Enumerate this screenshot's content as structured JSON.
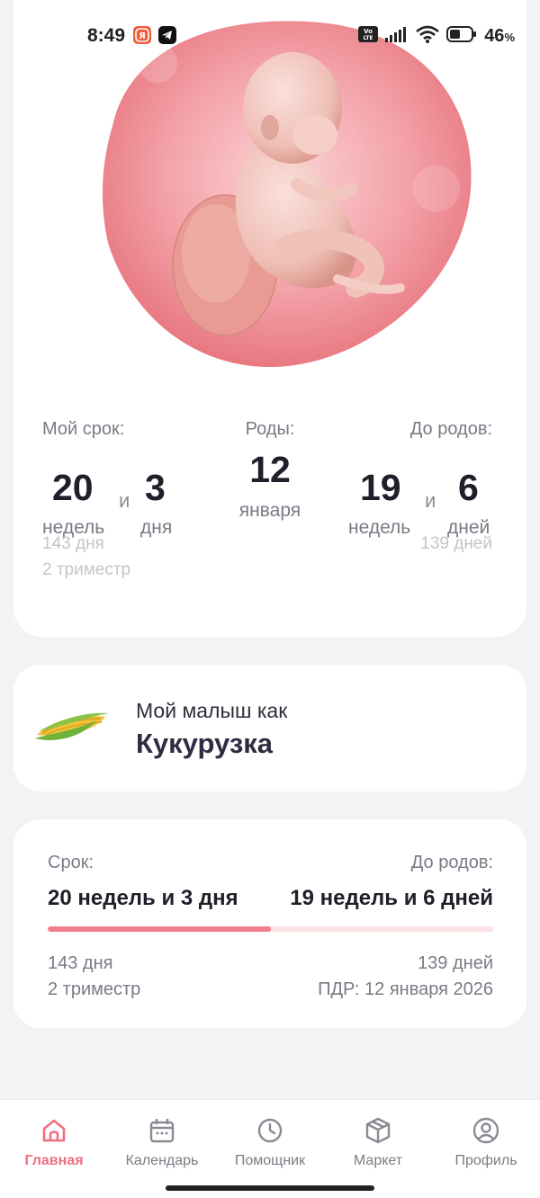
{
  "status_bar": {
    "time": "8:49",
    "battery": "46",
    "battery_unit": "%",
    "network_badge": "Vo LTE",
    "icons": [
      "yandex-app-icon",
      "telegram-icon",
      "volte-icon",
      "signal-icon",
      "wifi-icon",
      "battery-icon"
    ]
  },
  "colors": {
    "accent": "#ee6f80",
    "progress_fill": "#ee7f8b",
    "progress_track": "#fbe1e4",
    "background": "#f3f3f5"
  },
  "pregnancy": {
    "my_term_label": "Мой срок:",
    "weeks": "20",
    "and_1": "и",
    "days": "3",
    "weeks_unit": "недель",
    "days_unit": "дня",
    "total_days": "143 дня",
    "trimester": "2 триместр",
    "birth_label": "Роды:",
    "birth_day": "12",
    "birth_month": "января",
    "until_label": "До родов:",
    "until_weeks": "19",
    "and_2": "и",
    "until_days": "6",
    "until_weeks_unit": "недель",
    "until_days_unit": "дней",
    "until_total_days": "139 дней"
  },
  "baby_size": {
    "subtitle": "Мой малыш как",
    "title": "Кукурузка",
    "icon": "corn-icon"
  },
  "progress_card": {
    "term_label": "Срок:",
    "term_value": "20 недель и 3 дня",
    "until_label": "До родов:",
    "until_value": "19 недель и 6 дней",
    "progress": 0.5,
    "total_days": "143 дня",
    "trimester": "2 триместр",
    "remaining_days": "139 дней",
    "due_date": "ПДР: 12 января 2026"
  },
  "nav": {
    "items": [
      {
        "label": "Главная",
        "icon": "home-icon",
        "active": true
      },
      {
        "label": "Календарь",
        "icon": "calendar-icon",
        "active": false
      },
      {
        "label": "Помощник",
        "icon": "clock-icon",
        "active": false
      },
      {
        "label": "Маркет",
        "icon": "box-icon",
        "active": false
      },
      {
        "label": "Профиль",
        "icon": "profile-icon",
        "active": false
      }
    ]
  }
}
